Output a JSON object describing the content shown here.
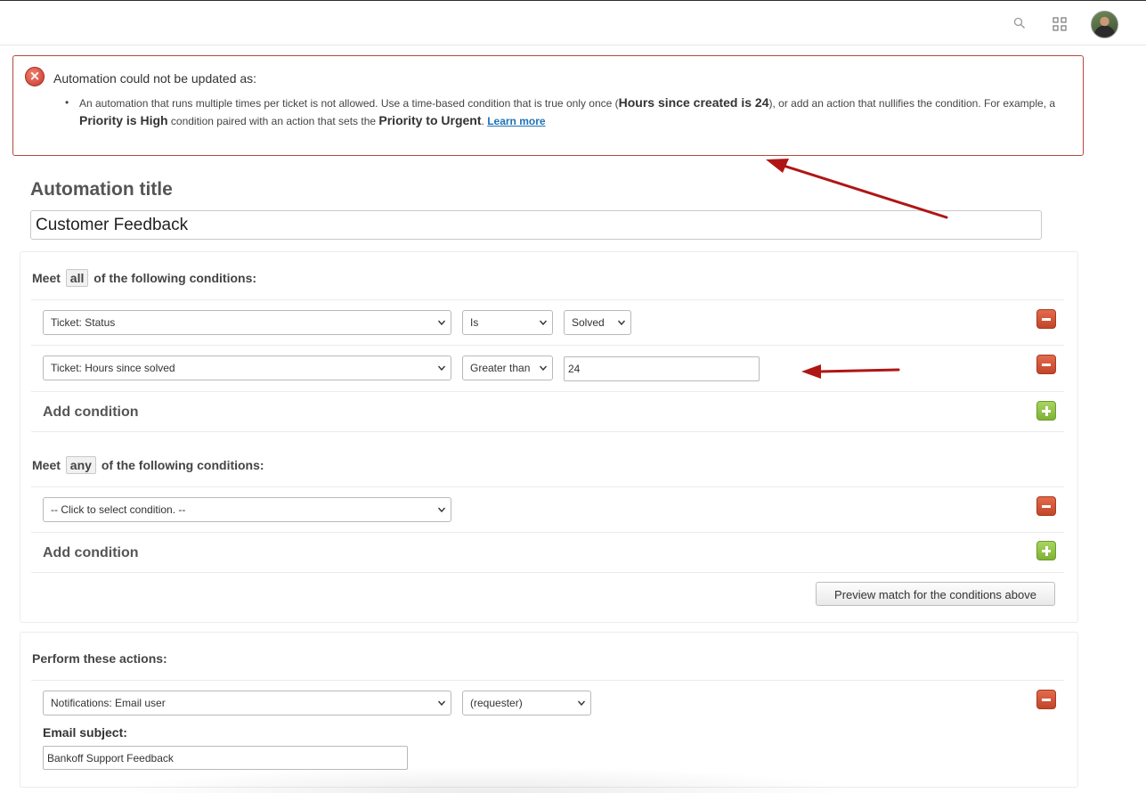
{
  "error": {
    "heading": "Automation could not be updated as:",
    "bullet": "•",
    "message_part1": "An automation that runs multiple times per ticket is not allowed. Use a time-based condition that is true only once (",
    "message_strong1": "Hours since created is 24",
    "message_part2": "), or add an action that nullifies the condition. For example, a ",
    "message_strong2": "Priority is High",
    "message_part3": " condition paired with an action that sets the ",
    "message_strong3": "Priority to Urgent",
    "message_part4": ". ",
    "learn_more": "Learn more"
  },
  "automation": {
    "title_label": "Automation title",
    "title_value": "Customer Feedback"
  },
  "all_conditions": {
    "prefix": "Meet",
    "keyword": "all",
    "suffix": "of the following conditions:",
    "rows": [
      {
        "field": "Ticket: Status",
        "operator": "Is",
        "value": "Solved"
      },
      {
        "field": "Ticket: Hours since solved",
        "operator": "Greater than",
        "value": "24"
      }
    ],
    "add_label": "Add condition"
  },
  "any_conditions": {
    "prefix": "Meet",
    "keyword": "any",
    "suffix": "of the following conditions:",
    "rows": [
      {
        "field": "-- Click to select condition. --"
      }
    ],
    "add_label": "Add condition"
  },
  "preview_button": "Preview match for the conditions above",
  "actions": {
    "label": "Perform these actions:",
    "rows": [
      {
        "field": "Notifications: Email user",
        "target": "(requester)"
      }
    ],
    "email_subject_label": "Email subject:",
    "email_subject_value": "Bankoff Support Feedback"
  },
  "colors": {
    "error_border": "#b5493f",
    "annotation_arrow": "#b01515",
    "remove_button": "#c2452a",
    "add_button": "#7fb236",
    "link": "#1f73b7"
  }
}
